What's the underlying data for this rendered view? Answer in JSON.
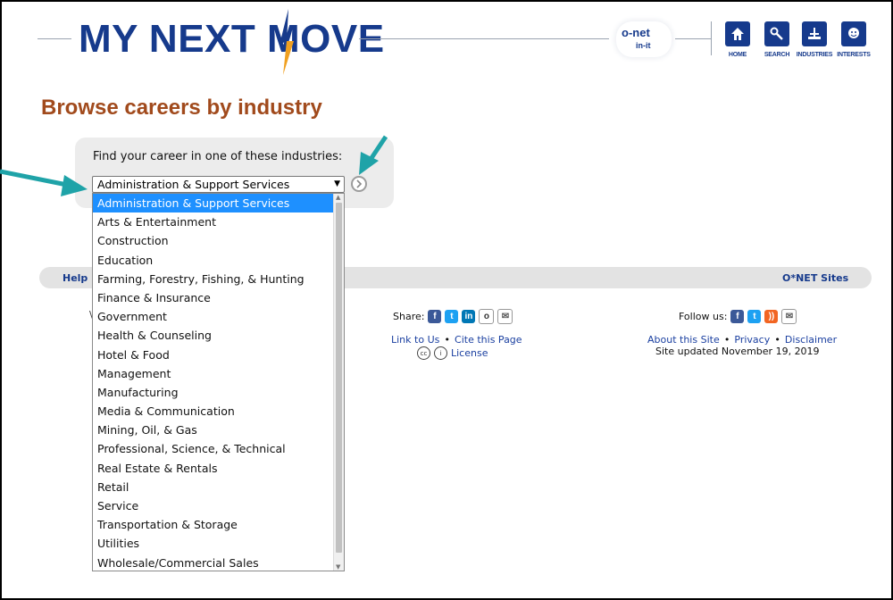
{
  "header": {
    "logo": "MY NEXT MOVE",
    "partner_badge": {
      "line1": "o-net",
      "line2": "in-it"
    },
    "nav": [
      {
        "label": "HOME",
        "icon": "home-icon"
      },
      {
        "label": "SEARCH",
        "icon": "key-icon"
      },
      {
        "label": "INDUSTRIES",
        "icon": "industries-icon"
      },
      {
        "label": "INTERESTS",
        "icon": "interests-icon"
      }
    ]
  },
  "page": {
    "title": "Browse careers by industry"
  },
  "form": {
    "label": "Find your career in one of these industries:",
    "selected": "Administration & Support Services",
    "options": [
      "Administration & Support Services",
      "Arts & Entertainment",
      "Construction",
      "Education",
      "Farming, Forestry, Fishing, & Hunting",
      "Finance & Insurance",
      "Government",
      "Health & Counseling",
      "Hotel & Food",
      "Management",
      "Manufacturing",
      "Media & Communication",
      "Mining, Oil, & Gas",
      "Professional, Science, & Technical",
      "Real Estate & Rentals",
      "Retail",
      "Service",
      "Transportation & Storage",
      "Utilities",
      "Wholesale/Commercial Sales"
    ]
  },
  "footer": {
    "help": "Help",
    "onet_sites": "O*NET Sites",
    "stray": "\\",
    "share_label": "Share:",
    "link_to_us": "Link to Us",
    "cite": "Cite this Page",
    "license": "License",
    "follow_label": "Follow us:",
    "about": "About this Site",
    "privacy": "Privacy",
    "disclaimer": "Disclaimer",
    "updated": "Site updated November 19, 2019",
    "bullet": "•"
  },
  "colors": {
    "brand_blue": "#163a8c",
    "title_brown": "#a14a1c",
    "selection_blue": "#1e90ff",
    "annotation_teal": "#1fa3a8"
  }
}
